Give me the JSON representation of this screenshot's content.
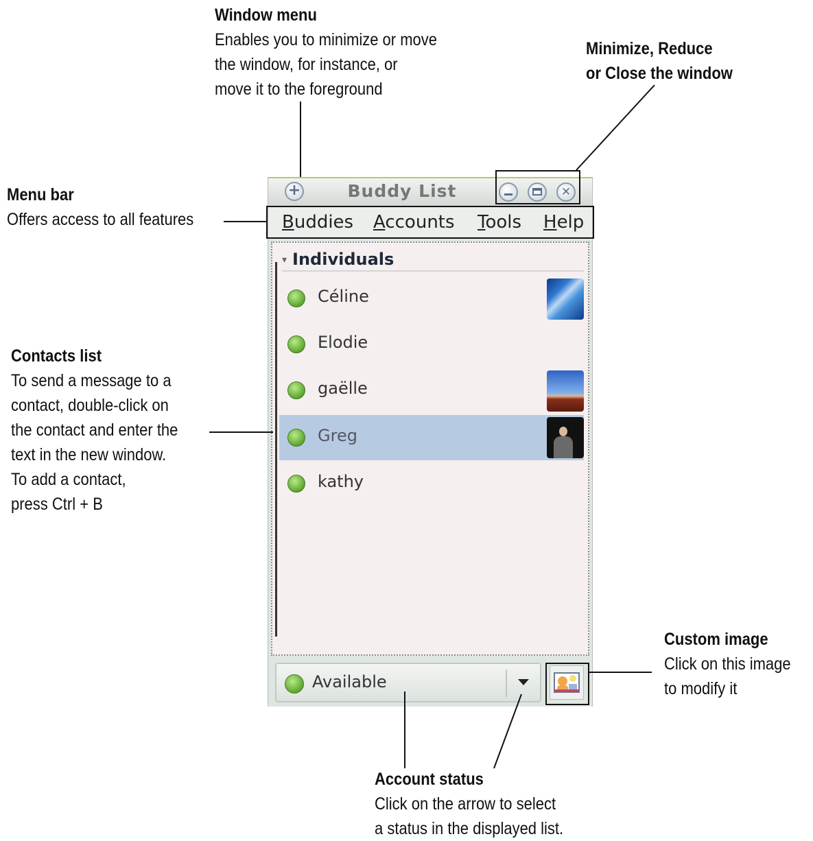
{
  "window": {
    "title": "Buddy List",
    "menu": [
      "Buddies",
      "Accounts",
      "Tools",
      "Help"
    ],
    "group": "Individuals",
    "contacts": [
      {
        "name": "Céline",
        "avatar": "ice-photo"
      },
      {
        "name": "Elodie",
        "avatar": null
      },
      {
        "name": "gaëlle",
        "avatar": "rock-photo"
      },
      {
        "name": "Greg",
        "avatar": "person-photo",
        "selected": true
      },
      {
        "name": "kathy",
        "avatar": null
      }
    ],
    "status": "Available",
    "icons": [
      "window-menu-icon",
      "minimize-icon",
      "maximize-icon",
      "close-icon",
      "status-dropdown-icon",
      "custom-image-icon"
    ]
  },
  "annotations": {
    "window_menu": {
      "title": "Window menu",
      "lines": [
        "Enables you to minimize or move",
        "the window, for instance, or",
        "move it to the foreground"
      ]
    },
    "min_close": {
      "title": "Minimize, Reduce",
      "lines": [
        "or Close the window"
      ]
    },
    "menu_bar": {
      "title": "Menu bar",
      "lines": [
        "Offers access to all features"
      ]
    },
    "contacts_list": {
      "title": "Contacts list",
      "lines": [
        "To send a message to a",
        "contact, double-click on",
        "the contact and enter the",
        "text in the new window.",
        "To add a contact,",
        "press Ctrl + B"
      ]
    },
    "custom_image": {
      "title": "Custom image",
      "lines": [
        "Click on this image",
        "to modify it"
      ]
    },
    "account_status": {
      "title": "Account status",
      "lines": [
        "Click on the arrow to select",
        "a status in the displayed list."
      ]
    }
  },
  "colors": {
    "selected_row": "#b6cbe1",
    "list_bg": "#f6efef",
    "status_green": "#5ea52e"
  }
}
